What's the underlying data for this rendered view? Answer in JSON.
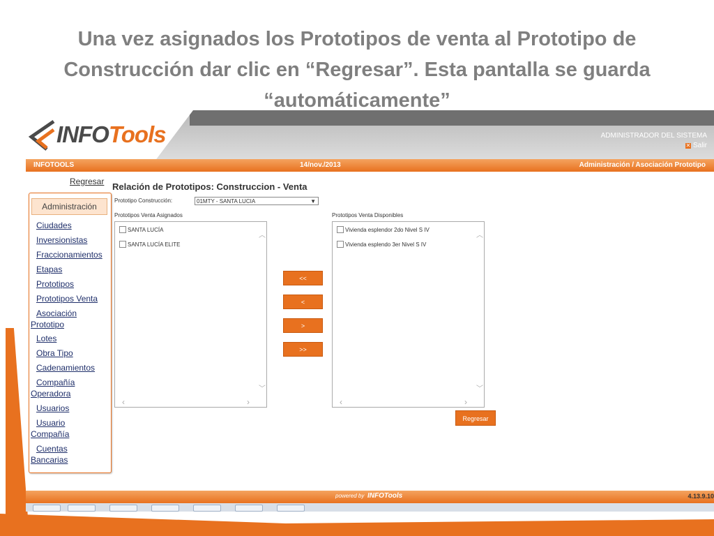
{
  "slide": {
    "title_line1": "Una vez asignados los Prototipos de venta al Prototipo de",
    "title_line2": "Construcción dar clic en “Regresar”. Esta pantalla se guarda",
    "title_line3": "“automáticamente”"
  },
  "header": {
    "logo_info": "INFO",
    "logo_tools": "Tools",
    "admin_label": "ADMINISTRADOR DEL SISTEMA",
    "salir_label": "Salir",
    "salir_icon": "x-icon"
  },
  "topbar": {
    "app_name": "INFOTOOLS",
    "date": "14/nov./2013",
    "breadcrumb": "Administración / Asociación Prototipo"
  },
  "sidebar": {
    "regresar_link": "Regresar",
    "section": "Administración",
    "items": [
      {
        "line1": "Ciudades",
        "line2": ""
      },
      {
        "line1": "Inversionistas",
        "line2": ""
      },
      {
        "line1": "Fraccionamientos",
        "line2": ""
      },
      {
        "line1": "Etapas",
        "line2": ""
      },
      {
        "line1": "Prototipos",
        "line2": ""
      },
      {
        "line1": "Prototipos Venta",
        "line2": ""
      },
      {
        "line1": "Asociación",
        "line2": "Prototipo"
      },
      {
        "line1": "Lotes",
        "line2": ""
      },
      {
        "line1": "Obra Tipo",
        "line2": ""
      },
      {
        "line1": "Cadenamientos",
        "line2": ""
      },
      {
        "line1": "Compañía",
        "line2": "Operadora"
      },
      {
        "line1": "Usuarios",
        "line2": ""
      },
      {
        "line1": "Usuario",
        "line2": "Compañía"
      },
      {
        "line1": "Cuentas",
        "line2": "Bancarias"
      }
    ]
  },
  "main": {
    "title": "Relación de Prototipos: Construccion - Venta",
    "prototipo_label": "Prototipo Construcción:",
    "prototipo_value": "01MTY - SANTA LUCIA",
    "assigned_label": "Prototipos Venta Asignados",
    "available_label": "Prototipos Venta Disponibles",
    "assigned_items": [
      "SANTA LUCÍA",
      "SANTA LUCÍA ELITE"
    ],
    "available_items": [
      "Vivienda esplendor 2do Nivel S IV",
      "Vivienda esplendo 3er Nivel S IV"
    ],
    "buttons": {
      "move_all_left": "<<",
      "move_left": "<",
      "move_right": ">",
      "move_all_right": ">>",
      "regresar": "Regresar"
    }
  },
  "footer": {
    "powered": "powered by",
    "powered_logo": "INFOTools",
    "version": "4.13.9.10"
  },
  "colors": {
    "accent": "#e8711f",
    "title_gray": "#7f7f7f",
    "link_blue": "#1f2f6a"
  }
}
